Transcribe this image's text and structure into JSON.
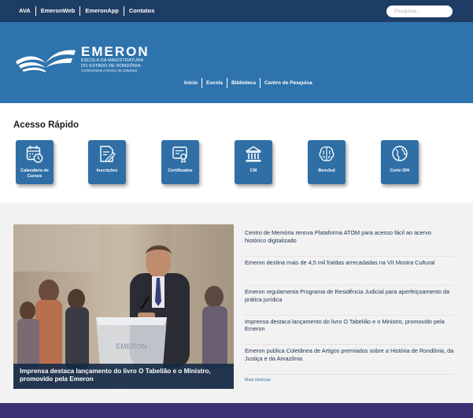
{
  "topbar": {
    "links": [
      "AVA",
      "EmeronWeb",
      "EmeronApp",
      "Contatos"
    ],
    "search_placeholder": "Pesquisar..."
  },
  "brand": {
    "name": "EMERON",
    "line1": "ESCOLA DA MAGISTRATURA",
    "line2": "DO ESTADO DE RONDÔNIA",
    "tagline": "Conhecimento a Serviço da Cidadania"
  },
  "nav": [
    "Início",
    "Escola",
    "Biblioteca",
    "Centro de Pesquisa"
  ],
  "quick_access": {
    "title": "Acesso Rápido",
    "items": [
      {
        "label": "Calendário de Cursos",
        "icon": "calendar-clock-icon"
      },
      {
        "label": "Inscrições",
        "icon": "edit-document-icon"
      },
      {
        "label": "Certificados",
        "icon": "certificate-icon"
      },
      {
        "label": "CM",
        "icon": "museum-icon"
      },
      {
        "label": "BemJud",
        "icon": "brain-icon"
      },
      {
        "label": "Corte IDH",
        "icon": "globe-icon"
      }
    ]
  },
  "news": {
    "featured_caption": "Imprensa destaca lançamento do livro O Tabelião e o Ministro, promovido pela Emeron",
    "podium_text": "EMERON",
    "items": [
      "Centro de Memória renova Plataforma ATOM para acesso fácil ao acervo histórico digitalizado",
      "Emeron destina mais de 4,5 mil fraldas arrecadadas na VII Mostra Cultural",
      "Emeron regulamenta Programa de Residência Judicial para aperfeiçoamento da prática jurídica",
      "Imprensa destaca lançamento do livro O Tabelião e o Ministro, promovido pela Emeron",
      "Emeron publica Coletânea de Artigos premiados sobre a História de Rondônia, da Justiça e da Amazônia"
    ],
    "more_label": "Mais Notícias"
  },
  "colors": {
    "topbar": "#1e3d64",
    "header": "#2e73ad",
    "card": "#2f6fa6",
    "footer": "#3a3176"
  }
}
